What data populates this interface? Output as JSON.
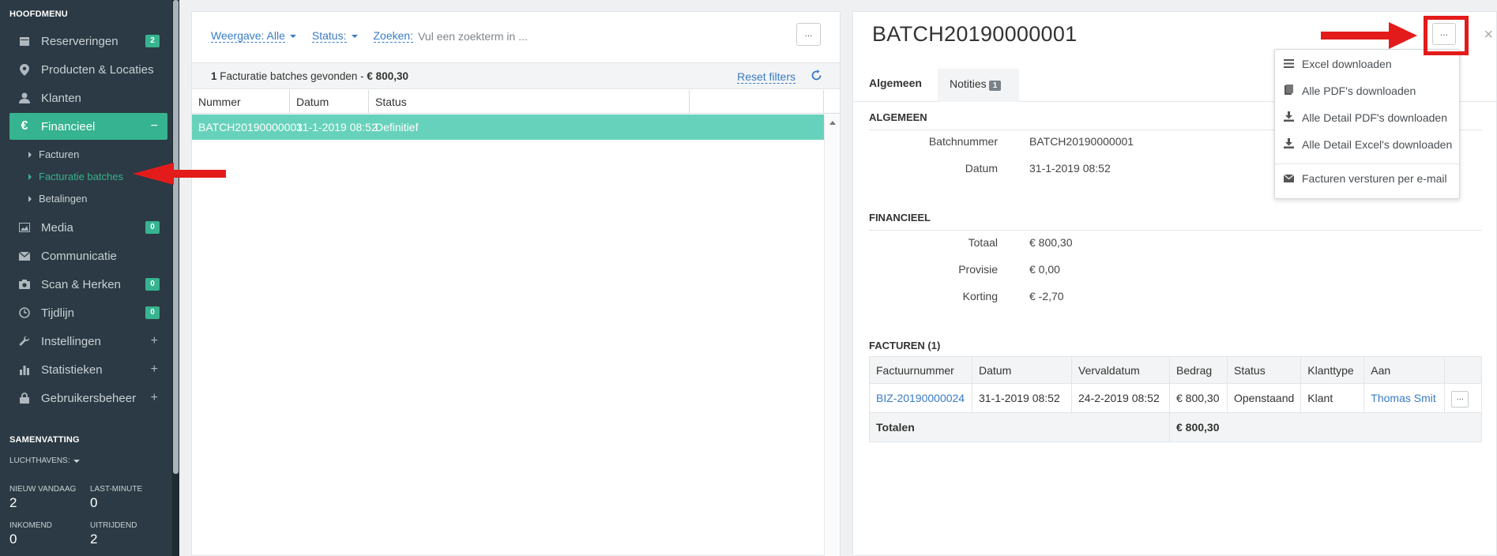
{
  "sidebar": {
    "heading": "HOOFDMENU",
    "items": [
      {
        "label": "Reserveringen",
        "badge": "2",
        "icon": "calendar-icon"
      },
      {
        "label": "Producten & Locaties",
        "icon": "map-marker-icon"
      },
      {
        "label": "Klanten",
        "icon": "user-icon"
      },
      {
        "label": "Financieel",
        "icon": "euro-icon",
        "toggle": "−",
        "active": true
      },
      {
        "label": "Media",
        "badge": "0",
        "icon": "image-icon"
      },
      {
        "label": "Communicatie",
        "icon": "envelope-icon"
      },
      {
        "label": "Scan & Herken",
        "badge": "0",
        "icon": "camera-icon"
      },
      {
        "label": "Tijdlijn",
        "badge": "0",
        "icon": "clock-icon"
      },
      {
        "label": "Instellingen",
        "toggle": "+",
        "icon": "wrench-icon"
      },
      {
        "label": "Statistieken",
        "toggle": "+",
        "icon": "bar-chart-icon"
      },
      {
        "label": "Gebruikersbeheer",
        "toggle": "+",
        "icon": "lock-icon"
      }
    ],
    "subitems": [
      "Facturen",
      "Facturatie batches",
      "Betalingen"
    ],
    "summary": {
      "heading": "SAMENVATTING",
      "filter": "LUCHTHAVENS:",
      "stats": [
        {
          "label": "NIEUW VANDAAG",
          "value": "2"
        },
        {
          "label": "LAST-MINUTE",
          "value": "0"
        },
        {
          "label": "INKOMEND",
          "value": "0"
        },
        {
          "label": "UITRIJDEND",
          "value": "2"
        }
      ]
    }
  },
  "list": {
    "filter_view": "Weergave: Alle",
    "filter_status": "Status:",
    "search_label": "Zoeken:",
    "search_placeholder": "Vul een zoekterm in ...",
    "more_button": "...",
    "found_count": "1",
    "found_text": "Facturatie batches gevonden -",
    "found_total": "€ 800,30",
    "reset_filters": "Reset filters",
    "columns": [
      "Nummer",
      "Datum",
      "Status"
    ],
    "rows": [
      {
        "nummer": "BATCH20190000001",
        "datum": "31-1-2019 08:52",
        "status": "Definitief"
      }
    ]
  },
  "detail": {
    "title": "BATCH20190000001",
    "more_button": "...",
    "close": "×",
    "tabs": {
      "general": "Algemeen",
      "notes": "Notities",
      "notes_count": "1"
    },
    "sections": {
      "general": {
        "heading": "ALGEMEEN",
        "fields": [
          {
            "key": "Batchnummer",
            "value": "BATCH20190000001"
          },
          {
            "key": "Datum",
            "value": "31-1-2019 08:52"
          }
        ]
      },
      "financial": {
        "heading": "FINANCIEEL",
        "fields": [
          {
            "key": "Totaal",
            "value": "€ 800,30"
          },
          {
            "key": "Provisie",
            "value": "€ 0,00"
          },
          {
            "key": "Korting",
            "value": "€ -2,70"
          }
        ]
      },
      "invoices": {
        "heading": "FACTUREN (1)",
        "columns": [
          "Factuurnummer",
          "Datum",
          "Vervaldatum",
          "Bedrag",
          "Status",
          "Klanttype",
          "Aan"
        ],
        "rows": [
          {
            "factuurnummer": "BIZ-20190000024",
            "datum": "31-1-2019 08:52",
            "vervaldatum": "24-2-2019 08:52",
            "bedrag": "€ 800,30",
            "status": "Openstaand",
            "klanttype": "Klant",
            "aan": "Thomas Smit",
            "action": "..."
          }
        ],
        "totals_label": "Totalen",
        "totals_value": "€ 800,30"
      }
    }
  },
  "dropdown": {
    "items": [
      {
        "label": "Excel downloaden",
        "icon": "list-icon"
      },
      {
        "label": "Alle PDF's downloaden",
        "icon": "document-icon"
      },
      {
        "label": "Alle Detail PDF's downloaden",
        "icon": "download-icon"
      },
      {
        "label": "Alle Detail Excel's downloaden",
        "icon": "download-icon"
      },
      {
        "label": "Facturen versturen per e-mail",
        "icon": "envelope-icon"
      }
    ]
  },
  "colors": {
    "accent": "#36b390",
    "selected_row": "#67d2bb",
    "sidebar_bg": "#2b3a44",
    "link": "#3a7cc4",
    "annotation": "#e41b1b"
  }
}
